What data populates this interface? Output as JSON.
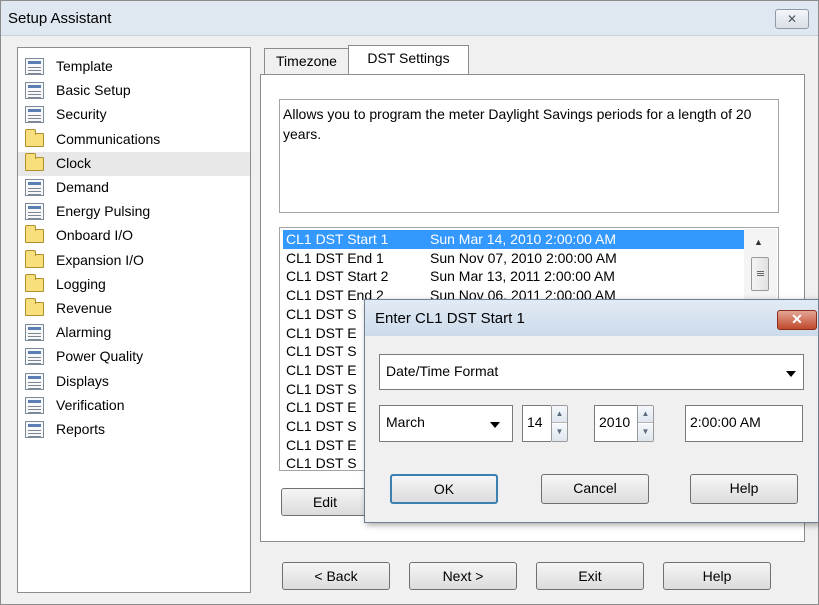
{
  "window": {
    "title": "Setup Assistant",
    "close_glyph": "✕"
  },
  "sidebar": {
    "items": [
      {
        "label": "Template",
        "icon": "document-icon"
      },
      {
        "label": "Basic Setup",
        "icon": "document-icon"
      },
      {
        "label": "Security",
        "icon": "document-icon"
      },
      {
        "label": "Communications",
        "icon": "folder-icon"
      },
      {
        "label": "Clock",
        "icon": "folder-icon"
      },
      {
        "label": "Demand",
        "icon": "document-icon"
      },
      {
        "label": "Energy Pulsing",
        "icon": "document-icon"
      },
      {
        "label": "Onboard I/O",
        "icon": "folder-icon"
      },
      {
        "label": "Expansion I/O",
        "icon": "folder-icon"
      },
      {
        "label": "Logging",
        "icon": "folder-icon"
      },
      {
        "label": "Revenue",
        "icon": "folder-icon"
      },
      {
        "label": "Alarming",
        "icon": "document-icon"
      },
      {
        "label": "Power Quality",
        "icon": "document-icon"
      },
      {
        "label": "Displays",
        "icon": "document-icon"
      },
      {
        "label": "Verification",
        "icon": "document-icon"
      },
      {
        "label": "Reports",
        "icon": "document-icon"
      }
    ],
    "selected": "Clock"
  },
  "tabs": [
    {
      "label": "Timezone"
    },
    {
      "label": "DST Settings"
    }
  ],
  "active_tab": "DST Settings",
  "description": "Allows you to program the meter Daylight Savings periods for a length of 20 years.",
  "dst_list": {
    "rows": [
      {
        "name": "CL1 DST Start 1",
        "value": "Sun Mar 14, 2010 2:00:00 AM"
      },
      {
        "name": "CL1 DST End 1",
        "value": "Sun Nov 07, 2010 2:00:00 AM"
      },
      {
        "name": "CL1 DST Start 2",
        "value": "Sun Mar 13, 2011 2:00:00 AM"
      },
      {
        "name": "CL1 DST End 2",
        "value": "Sun Nov 06, 2011 2:00:00 AM"
      },
      {
        "name": "CL1 DST S",
        "value": ""
      },
      {
        "name": "CL1 DST E",
        "value": ""
      },
      {
        "name": "CL1 DST S",
        "value": ""
      },
      {
        "name": "CL1 DST E",
        "value": ""
      },
      {
        "name": "CL1 DST S",
        "value": ""
      },
      {
        "name": "CL1 DST E",
        "value": ""
      },
      {
        "name": "CL1 DST S",
        "value": ""
      },
      {
        "name": "CL1 DST E",
        "value": ""
      },
      {
        "name": "CL1 DST S",
        "value": ""
      }
    ],
    "selected_index": 0
  },
  "panel_buttons": {
    "edit": "Edit"
  },
  "footer": {
    "back": "< Back",
    "next": "Next >",
    "exit": "Exit",
    "help": "Help"
  },
  "dialog": {
    "title": "Enter CL1 DST Start 1",
    "format_select": "Date/Time Format",
    "month": "March",
    "day": "14",
    "year": "2010",
    "time": "2:00:00 AM",
    "ok": "OK",
    "cancel": "Cancel",
    "help": "Help",
    "close_glyph": "✕"
  },
  "colors": {
    "selection": "#3399ff",
    "dialog_close": "#c0492c"
  }
}
